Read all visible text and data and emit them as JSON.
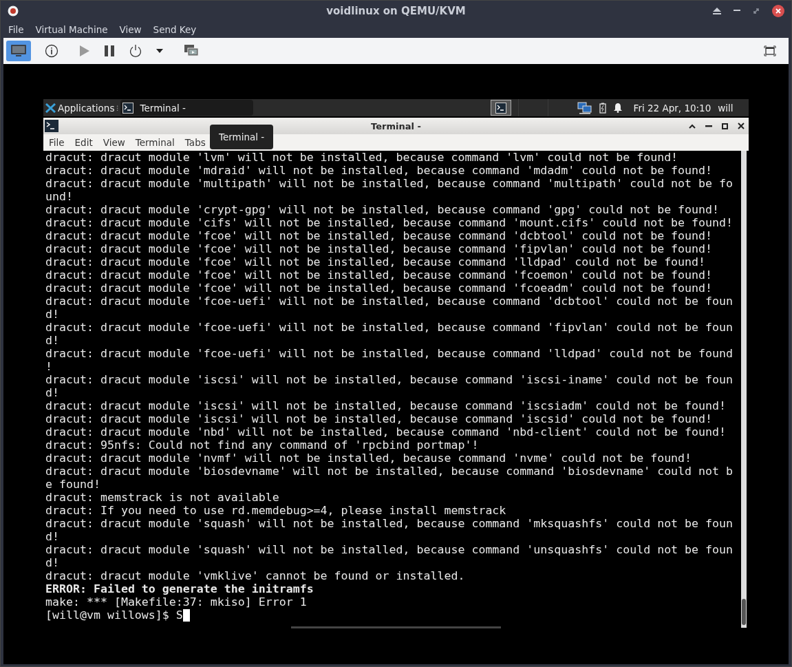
{
  "window": {
    "title": "voidlinux on QEMU/KVM"
  },
  "menu": [
    "File",
    "Virtual Machine",
    "View",
    "Send Key"
  ],
  "toolbar": {
    "console_selected": true
  },
  "guest": {
    "panel": {
      "apps_label": "Applications",
      "separator": "⁝",
      "task_label": "Terminal -",
      "clock": "Fri 22 Apr, 10:10",
      "user": "will"
    },
    "terminal": {
      "title": "Terminal -",
      "menu": [
        "File",
        "Edit",
        "View",
        "Terminal",
        "Tabs"
      ],
      "tooltip": "Terminal -",
      "lines": [
        {
          "text": "dracut: dracut module 'lvm' will not be installed, because command 'lvm' could not be found!",
          "kind": "normal"
        },
        {
          "text": "dracut: dracut module 'mdraid' will not be installed, because command 'mdadm' could not be found!",
          "kind": "normal"
        },
        {
          "text": "dracut: dracut module 'multipath' will not be installed, because command 'multipath' could not be fo",
          "kind": "normal"
        },
        {
          "text": "und!",
          "kind": "normal"
        },
        {
          "text": "dracut: dracut module 'crypt-gpg' will not be installed, because command 'gpg' could not be found!",
          "kind": "normal"
        },
        {
          "text": "dracut: dracut module 'cifs' will not be installed, because command 'mount.cifs' could not be found!",
          "kind": "normal"
        },
        {
          "text": "dracut: dracut module 'fcoe' will not be installed, because command 'dcbtool' could not be found!",
          "kind": "normal"
        },
        {
          "text": "dracut: dracut module 'fcoe' will not be installed, because command 'fipvlan' could not be found!",
          "kind": "normal"
        },
        {
          "text": "dracut: dracut module 'fcoe' will not be installed, because command 'lldpad' could not be found!",
          "kind": "normal"
        },
        {
          "text": "dracut: dracut module 'fcoe' will not be installed, because command 'fcoemon' could not be found!",
          "kind": "normal"
        },
        {
          "text": "dracut: dracut module 'fcoe' will not be installed, because command 'fcoeadm' could not be found!",
          "kind": "normal"
        },
        {
          "text": "dracut: dracut module 'fcoe-uefi' will not be installed, because command 'dcbtool' could not be foun",
          "kind": "normal"
        },
        {
          "text": "d!",
          "kind": "normal"
        },
        {
          "text": "dracut: dracut module 'fcoe-uefi' will not be installed, because command 'fipvlan' could not be foun",
          "kind": "normal"
        },
        {
          "text": "d!",
          "kind": "normal"
        },
        {
          "text": "dracut: dracut module 'fcoe-uefi' will not be installed, because command 'lldpad' could not be found",
          "kind": "normal"
        },
        {
          "text": "!",
          "kind": "normal"
        },
        {
          "text": "dracut: dracut module 'iscsi' will not be installed, because command 'iscsi-iname' could not be foun",
          "kind": "normal"
        },
        {
          "text": "d!",
          "kind": "normal"
        },
        {
          "text": "dracut: dracut module 'iscsi' will not be installed, because command 'iscsiadm' could not be found!",
          "kind": "normal"
        },
        {
          "text": "dracut: dracut module 'iscsi' will not be installed, because command 'iscsid' could not be found!",
          "kind": "normal"
        },
        {
          "text": "dracut: dracut module 'nbd' will not be installed, because command 'nbd-client' could not be found!",
          "kind": "normal"
        },
        {
          "text": "dracut: 95nfs: Could not find any command of 'rpcbind portmap'!",
          "kind": "normal"
        },
        {
          "text": "dracut: dracut module 'nvmf' will not be installed, because command 'nvme' could not be found!",
          "kind": "normal"
        },
        {
          "text": "dracut: dracut module 'biosdevname' will not be installed, because command 'biosdevname' could not b",
          "kind": "normal"
        },
        {
          "text": "e found!",
          "kind": "normal"
        },
        {
          "text": "dracut: memstrack is not available",
          "kind": "normal"
        },
        {
          "text": "dracut: If you need to use rd.memdebug>=4, please install memstrack",
          "kind": "normal"
        },
        {
          "text": "dracut: dracut module 'squash' will not be installed, because command 'mksquashfs' could not be foun",
          "kind": "normal"
        },
        {
          "text": "d!",
          "kind": "normal"
        },
        {
          "text": "dracut: dracut module 'squash' will not be installed, because command 'unsquashfs' could not be foun",
          "kind": "normal"
        },
        {
          "text": "d!",
          "kind": "normal"
        },
        {
          "text": "dracut: dracut module 'vmklive' cannot be found or installed.",
          "kind": "normal"
        },
        {
          "text": "ERROR: Failed to generate the initramfs",
          "kind": "bold"
        },
        {
          "text": "make: *** [Makefile:37: mkiso] Error 1",
          "kind": "normal"
        },
        {
          "text": "[will@vm willows]$ S",
          "kind": "prompt"
        }
      ]
    }
  }
}
